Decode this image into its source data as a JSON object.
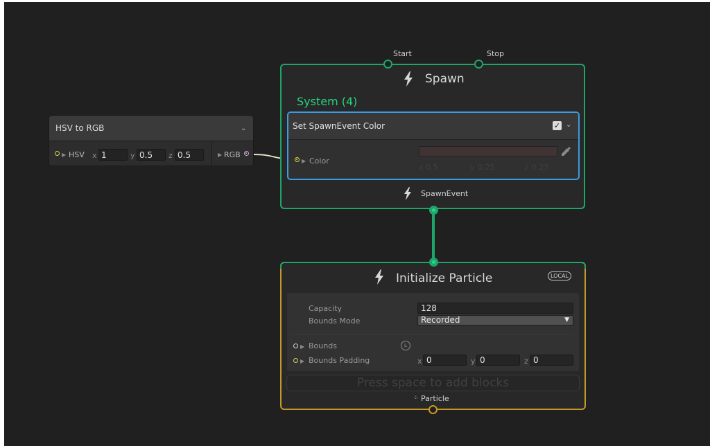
{
  "colors": {
    "background": "#202020",
    "spawn_border": "#1ea66a",
    "system_label": "#27d37f",
    "block_selected": "#3c9be2",
    "init_border": "#c6982b",
    "port_yellow": "#d8d450",
    "port_pink": "#d9a5e6"
  },
  "hsv_node": {
    "title": "HSV to RGB",
    "input_label": "HSV",
    "output_label": "RGB",
    "x_label": "x",
    "x_value": "1",
    "y_label": "y",
    "y_value": "0.5",
    "z_label": "z",
    "z_value": "0.5",
    "collapse_icon": "chevron-down-icon"
  },
  "spawn_context": {
    "title": "Spawn",
    "start_label": "Start",
    "stop_label": "Stop",
    "system_label": "System (4)",
    "output_label": "SpawnEvent",
    "icon": "lightning-icon",
    "block": {
      "title": "Set SpawnEvent Color",
      "enabled_check": "✓",
      "color_label": "Color",
      "x_label": "x",
      "x_value": "0.5",
      "y_label": "y",
      "y_value": "0.25",
      "z_label": "z",
      "z_value": "0.25",
      "picker_icon": "eyedropper-icon"
    }
  },
  "init_context": {
    "title": "Initialize Particle",
    "space_badge": "LOCAL",
    "capacity_label": "Capacity",
    "capacity_value": "128",
    "bounds_mode_label": "Bounds Mode",
    "bounds_mode_value": "Recorded",
    "bounds_label": "Bounds",
    "bounds_space_badge": "L",
    "bounds_padding_label": "Bounds Padding",
    "pad_x_label": "x",
    "pad_x_value": "0",
    "pad_y_label": "y",
    "pad_y_value": "0",
    "pad_z_label": "z",
    "pad_z_value": "0",
    "add_blocks_hint": "Press space to add blocks",
    "output_label": "Particle"
  }
}
